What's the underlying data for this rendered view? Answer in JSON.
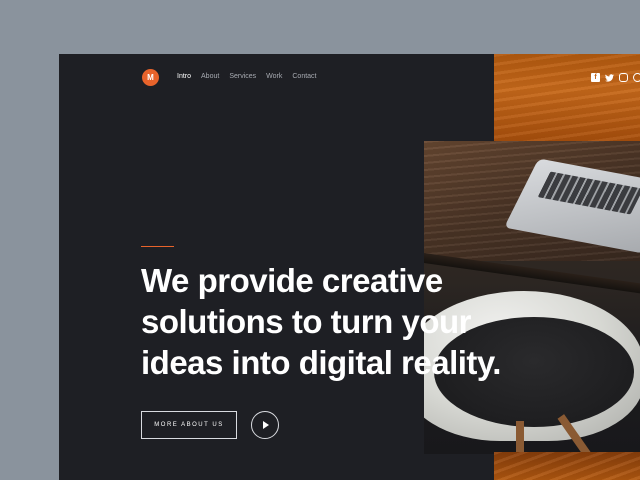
{
  "brand": {
    "logo_letter": "M",
    "accent": "#e8632b"
  },
  "nav": {
    "items": [
      "Intro",
      "About",
      "Services",
      "Work",
      "Contact"
    ],
    "active": "Intro"
  },
  "social": {
    "facebook": "f",
    "twitter": "t",
    "instagram": "ig",
    "dribbble": "d"
  },
  "hero": {
    "headline_lines": [
      "We provide creative",
      "solutions to turn your",
      "ideas into digital reality."
    ],
    "cta_label": "MORE ABOUT US"
  },
  "colors": {
    "page_bg": "#1e1f24",
    "outer_bg": "#8a939d",
    "text": "#ffffff",
    "nav_text": "#a8abb2"
  }
}
